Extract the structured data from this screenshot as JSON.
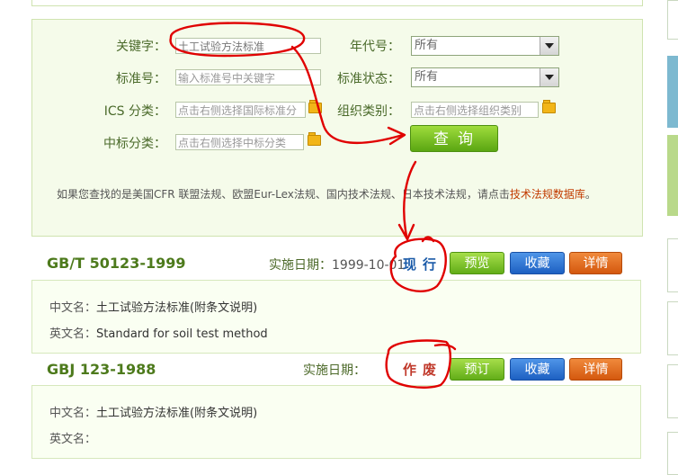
{
  "search": {
    "keyword_label": "关键字：",
    "keyword_value": "土工试验方法标准",
    "year_label": "年代号：",
    "year_value": "所有",
    "standard_no_label": "标准号：",
    "standard_no_placeholder": "输入标准号中关键字",
    "status_label": "标准状态：",
    "status_value": "所有",
    "ics_label": "ICS 分类：",
    "ics_placeholder": "点击右侧选择国际标准分",
    "org_label": "组织类别：",
    "org_placeholder": "点击右侧选择组织类别",
    "ccs_label": "中标分类：",
    "ccs_placeholder": "点击右侧选择中标分类",
    "search_button": "查询",
    "notice_text": "如果您查找的是美国CFR 联盟法规、欧盟Eur-Lex法规、国内技术法规、日本技术法规，请点击",
    "notice_link": "技术法规数据库",
    "notice_end": "。"
  },
  "results": [
    {
      "code": "GB/T 50123-1999",
      "date_label": "实施日期：",
      "date_value": "1999-10-01",
      "status": "现行",
      "status_color": "#1a5aa8",
      "buttons": [
        "预览",
        "收藏",
        "详情"
      ],
      "cn_label": "中文名：",
      "cn_value": "土工试验方法标准(附条文说明)",
      "en_label": "英文名：",
      "en_value": "Standard for soil test method"
    },
    {
      "code": "GBJ 123-1988",
      "date_label": "实施日期：",
      "date_value": "",
      "status": "作废",
      "status_color": "#c0392b",
      "buttons": [
        "预订",
        "收藏",
        "详情"
      ],
      "cn_label": "中文名：",
      "cn_value": "土工试验方法标准(附条文说明)",
      "en_label": "英文名：",
      "en_value": ""
    }
  ],
  "icons": {
    "folder": "folder-icon",
    "dropdown": "chevron-down-icon"
  },
  "colors": {
    "panel_bg": "#f5fbea",
    "accent_green": "#62ad18",
    "accent_blue": "#1d60c2",
    "accent_orange": "#d4580e",
    "annotation_red": "#e00000"
  }
}
